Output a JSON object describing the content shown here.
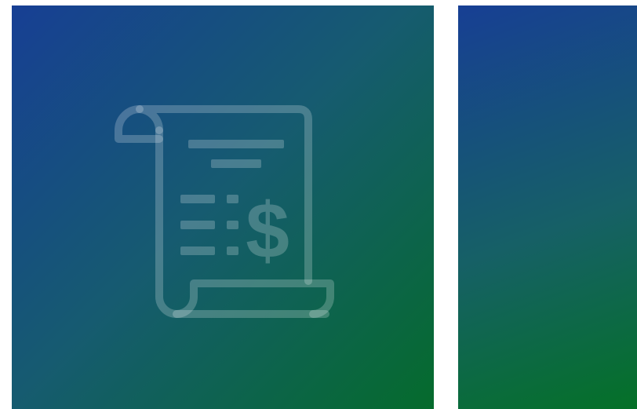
{
  "cards": [
    {
      "id": "card-left",
      "icon": "receipt-dollar-icon",
      "gradient": {
        "from": "#173f94",
        "mid": "#165b70",
        "to": "#056b2c"
      },
      "icon_color": "#ffffff",
      "icon_opacity": 0.2
    },
    {
      "id": "card-right",
      "icon": null,
      "gradient": {
        "from": "#173f94",
        "mid": "#166066",
        "to": "#047126"
      }
    }
  ]
}
